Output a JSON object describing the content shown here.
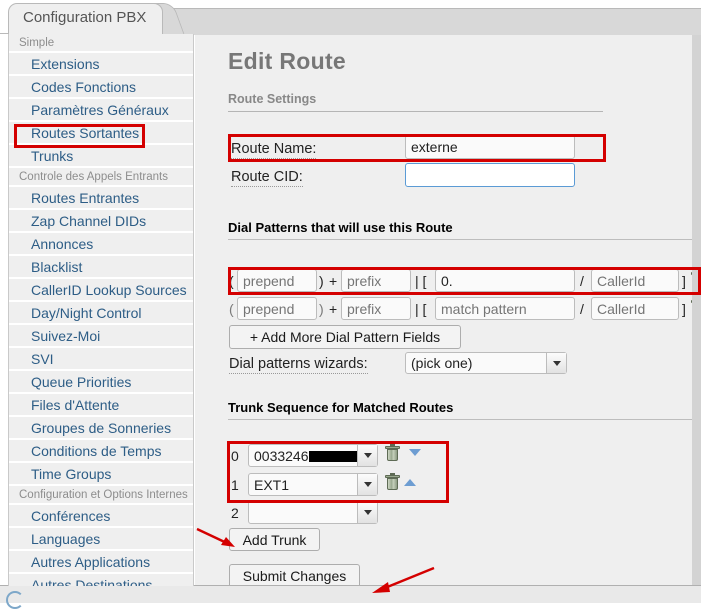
{
  "tab": {
    "label": "Configuration PBX"
  },
  "sidebar": {
    "groups": [
      {
        "label": "Simple",
        "items": [
          "Extensions",
          "Codes Fonctions",
          "Paramètres Généraux",
          "Routes Sortantes",
          "Trunks"
        ]
      },
      {
        "label": "Controle des Appels Entrants",
        "items": [
          "Routes Entrantes",
          "Zap Channel DIDs",
          "Annonces",
          "Blacklist",
          "CallerID Lookup Sources",
          "Day/Night Control",
          "Suivez-Moi",
          "SVI",
          "Queue Priorities",
          "Files d'Attente",
          "Groupes de Sonneries",
          "Conditions de Temps",
          "Time Groups"
        ]
      },
      {
        "label": "Configuration et Options Internes",
        "items": [
          "Conférences",
          "Languages",
          "Autres Applications",
          "Autres Destinations"
        ]
      }
    ],
    "selected": "Routes Sortantes"
  },
  "main": {
    "title": "Edit Route",
    "sections": {
      "route_settings": "Route Settings",
      "dial_patterns": "Dial Patterns that will use this Route",
      "trunk_sequence": "Trunk Sequence for Matched Routes"
    },
    "route_name": {
      "label": "Route Name:",
      "value": "externe"
    },
    "route_cid": {
      "label": "Route CID:",
      "value": "",
      "placeholder": ""
    },
    "dial_patterns": {
      "open_paren": "(",
      "close_paren": ")",
      "plus": "+",
      "pipe_bracket": "| [",
      "slash": "/",
      "close_bracket": "]",
      "rows": [
        {
          "prepend": "",
          "prepend_ph": "prepend",
          "prefix": "",
          "prefix_ph": "prefix",
          "match": "0.",
          "match_ph": "match pattern",
          "callerid": "",
          "callerid_ph": "CallerId",
          "highlighted": true
        },
        {
          "prepend": "",
          "prepend_ph": "prepend",
          "prefix": "",
          "prefix_ph": "prefix",
          "match": "",
          "match_ph": "match pattern",
          "callerid": "",
          "callerid_ph": "CallerId",
          "highlighted": false
        }
      ],
      "add_more_label": "+ Add More Dial Pattern Fields",
      "wizards_label": "Dial patterns wizards:",
      "wizards_value": "(pick one)"
    },
    "trunks": {
      "rows": [
        {
          "index": "0",
          "value": "0033246",
          "redacted": true,
          "move": "down"
        },
        {
          "index": "1",
          "value": "EXT1",
          "redacted": false,
          "move": "up"
        },
        {
          "index": "2",
          "value": "",
          "redacted": false,
          "move": ""
        }
      ],
      "add_trunk_label": "Add Trunk"
    },
    "submit_label": "Submit Changes"
  },
  "colors": {
    "annotation": "#d40000",
    "link": "#2d5d86",
    "focus": "#5b9bd5",
    "sidebar_bg": "#efefef"
  }
}
